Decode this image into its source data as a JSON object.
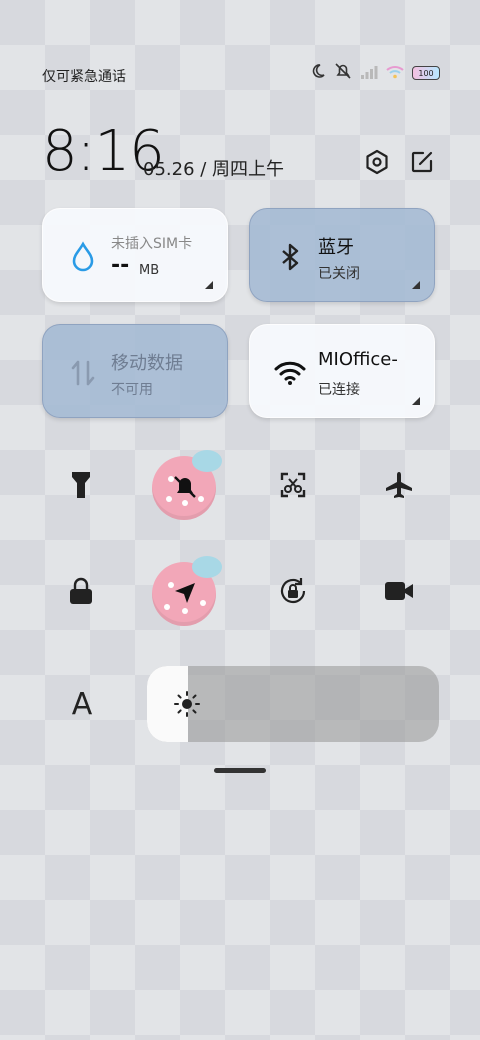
{
  "status_bar": {
    "carrier_text": "仅可紧急通话",
    "battery_text": "100",
    "icons": [
      "moon-icon",
      "bell-mute-icon",
      "signal-icon",
      "wifi-icon",
      "battery-icon"
    ]
  },
  "header": {
    "time": "8:16",
    "date": "05.26 / 周四上午",
    "icons": [
      "settings-hex-icon",
      "edit-icon"
    ]
  },
  "tiles": [
    {
      "title": "未插入SIM卡",
      "value": "--",
      "unit": "MB",
      "icon": "water-drop-icon",
      "accent": "#2a9be6"
    },
    {
      "title": "蓝牙",
      "subtitle": "已关闭",
      "icon": "bluetooth-icon"
    },
    {
      "title": "移动数据",
      "subtitle": "不可用",
      "icon": "mobile-data-icon"
    },
    {
      "title": "MIOffice-",
      "subtitle": "已连接",
      "icon": "wifi-icon"
    }
  ],
  "toggles_row1": [
    "flashlight-icon",
    "mute-bell-icon",
    "screenshot-icon",
    "airplane-icon"
  ],
  "toggles_row2": [
    "lock-icon",
    "location-icon",
    "rotation-lock-icon",
    "video-camera-icon"
  ],
  "brightness": {
    "level": 0.14,
    "icon": "sun-icon"
  },
  "font_button": "A"
}
